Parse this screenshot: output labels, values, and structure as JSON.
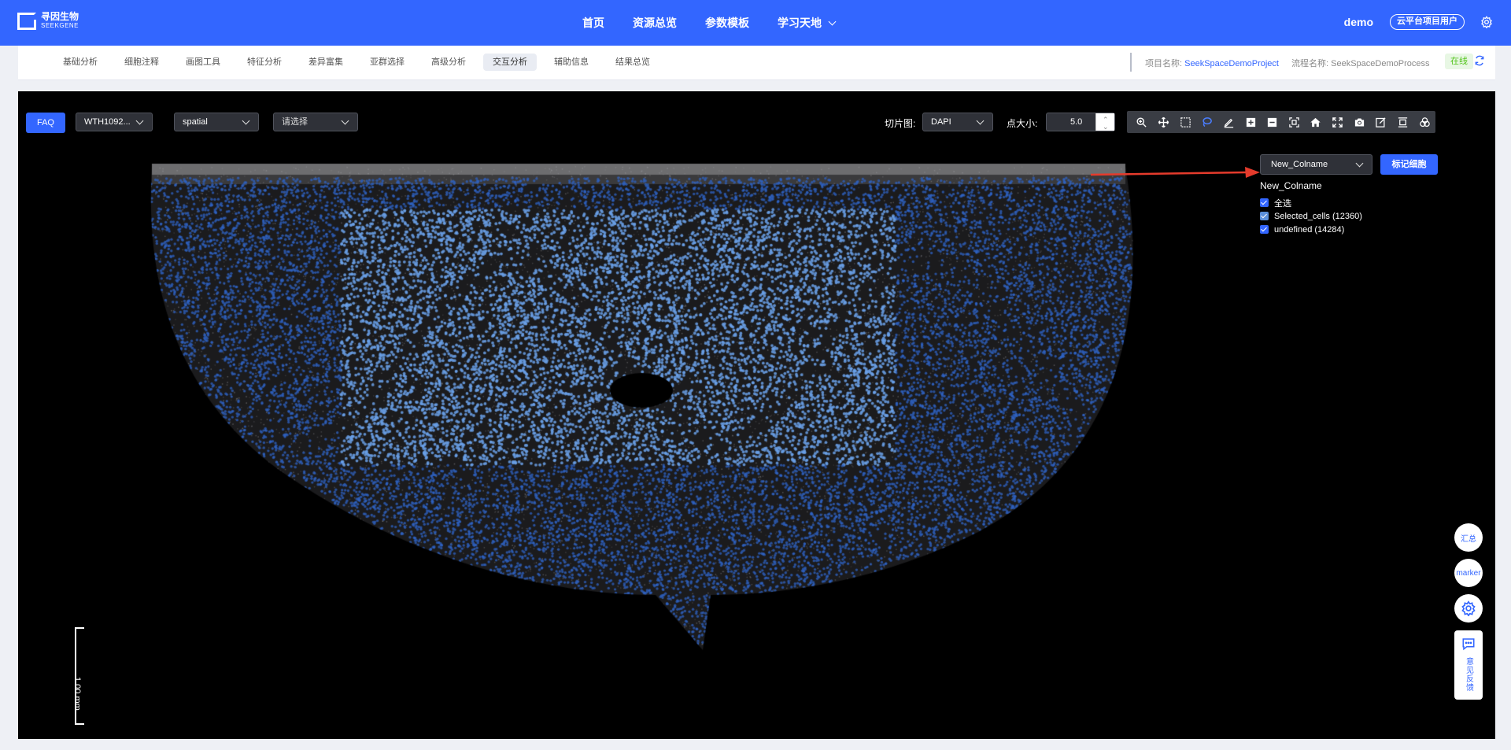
{
  "brand": {
    "name_cn": "寻因生物",
    "name_en": "SEEKGENE"
  },
  "nav": {
    "items": [
      "首页",
      "资源总览",
      "参数模板",
      "学习天地"
    ]
  },
  "user": {
    "name": "demo",
    "role": "云平台项目用户"
  },
  "subnav": {
    "tabs": [
      "基础分析",
      "细胞注释",
      "画图工具",
      "特征分析",
      "差异富集",
      "亚群选择",
      "高级分析",
      "交互分析",
      "辅助信息",
      "结果总览"
    ],
    "active": "交互分析",
    "project_label": "项目名称: ",
    "project_name": "SeekSpaceDemoProject",
    "process_label": "流程名称: ",
    "process_name": "SeekSpaceDemoProcess",
    "status": "在线"
  },
  "controls": {
    "faq": "FAQ",
    "sample": "WTH1092...",
    "embedding": "spatial",
    "group_placeholder": "请选择",
    "slice_label": "切片图:",
    "slice_value": "DAPI",
    "pointsize_label": "点大小:",
    "pointsize_value": "5.0"
  },
  "toolbar": [
    "zoom-in-icon",
    "pan-icon",
    "box-select-icon",
    "lasso-icon",
    "draw-icon",
    "plus-icon",
    "minus-icon",
    "fit-icon",
    "home-icon",
    "fullscreen-icon",
    "camera-icon",
    "edit-icon",
    "align-icon",
    "venn-icon"
  ],
  "colname": {
    "value": "New_Colname",
    "button": "标记细胞"
  },
  "legend": {
    "title": "New_Colname",
    "items": [
      {
        "label": "全选",
        "color": "#3366ff"
      },
      {
        "label": "Selected_cells (12360)",
        "color": "#5b8fd9"
      },
      {
        "label": "undefined (14284)",
        "color": "#3366ff"
      }
    ]
  },
  "scale": {
    "label": "1.00 mm"
  },
  "side": {
    "summary": "汇总",
    "marker": "marker",
    "feedback": "意见反馈"
  },
  "colors": {
    "primary": "#3366ff",
    "selected_cells": "#6aa0e8",
    "undefined_cells": "#2f63c4",
    "online": "#52c41a"
  }
}
